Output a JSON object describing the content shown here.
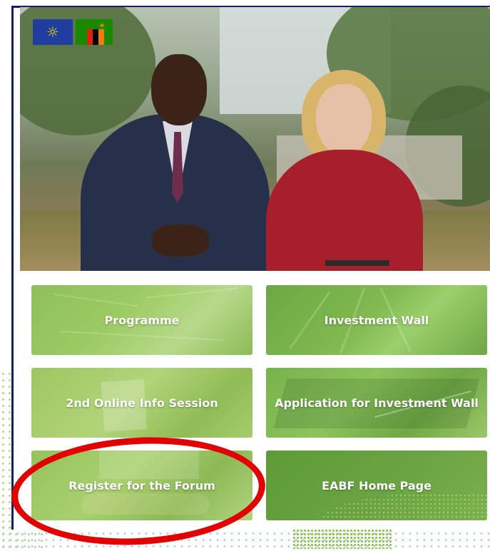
{
  "hero": {
    "flags": [
      "eu-flag-icon",
      "zambia-flag-icon"
    ]
  },
  "tiles": [
    {
      "label": "Programme"
    },
    {
      "label": "Investment Wall"
    },
    {
      "label": "2nd Online Info Session"
    },
    {
      "label": "Application for Investment Wall"
    },
    {
      "label": "Register for the Forum"
    },
    {
      "label": "EABF Home Page"
    }
  ],
  "colors": {
    "frame": "#17205c",
    "tile_green": "#8cc63f",
    "tile_dark_green": "#6aa442",
    "annotation_red": "#e30000"
  }
}
